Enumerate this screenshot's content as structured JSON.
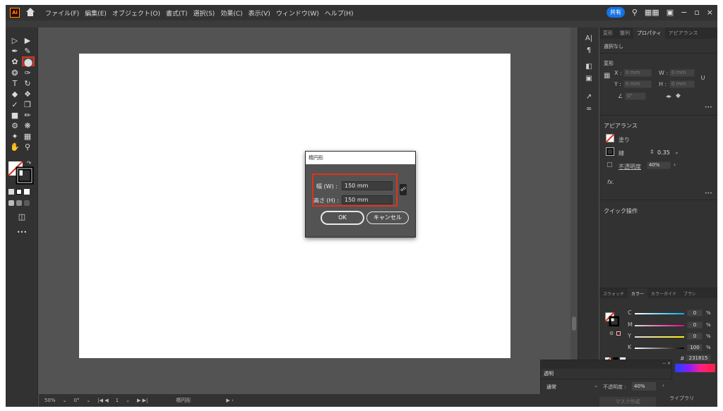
{
  "app": {
    "logo": "Ai"
  },
  "menu": [
    "ファイル(F)",
    "編集(E)",
    "オブジェクト(O)",
    "書式(T)",
    "選択(S)",
    "効果(C)",
    "表示(V)",
    "ウィンドウ(W)",
    "ヘルプ(H)"
  ],
  "menu_right": {
    "share": "共有",
    "search_icon": "search-icon",
    "layout_icon": "workspace-icon",
    "min": "−",
    "max": "▫",
    "close": "×"
  },
  "right_panel": {
    "tabs": [
      "変形",
      "整列",
      "プロパティ",
      "アピアランス"
    ],
    "active_tab": "プロパティ",
    "selection": "選択なし",
    "transform_title": "変形",
    "x_label": "X :",
    "x_value": "0 mm",
    "y_label": "Y :",
    "y_value": "0 mm",
    "w_label": "W :",
    "w_value": "0 mm",
    "h_label": "H :",
    "h_value": "0 mm",
    "angle_value": "0°",
    "appearance_title": "アピアランス",
    "fill_label": "塗り",
    "stroke_label": "線",
    "stroke_weight": "0.35",
    "opacity_label": "不透明度",
    "opacity_value": "40%",
    "fx": "fx.",
    "quick_actions": "クイック操作",
    "more": "•••"
  },
  "color_panel": {
    "tabs": [
      "スウォッチ",
      "カラー",
      "カラーガイド",
      "ブラシ"
    ],
    "active_tab": "カラー",
    "channels": [
      {
        "label": "C",
        "value": "0",
        "unit": "%"
      },
      {
        "label": "M",
        "value": "0",
        "unit": "%"
      },
      {
        "label": "Y",
        "value": "0",
        "unit": "%"
      },
      {
        "label": "K",
        "value": "100",
        "unit": "%"
      }
    ],
    "hex_label": "#",
    "hex_value": "231815"
  },
  "dialog": {
    "title": "楕円形",
    "width_label": "幅 (W) :",
    "width_value": "150 mm",
    "height_label": "高さ (H) :",
    "height_value": "150 mm",
    "ok": "OK",
    "cancel": "キャンセル"
  },
  "transparency_panel": {
    "title": "透明",
    "blend_mode": "通常",
    "opacity_label": "不透明度 :",
    "opacity_value": "40%",
    "mask_button": "マスク作成",
    "library": "ライブラリ"
  },
  "status": {
    "zoom": "50%",
    "rotation": "0°",
    "artboard": "1",
    "tool": "楕円形"
  }
}
